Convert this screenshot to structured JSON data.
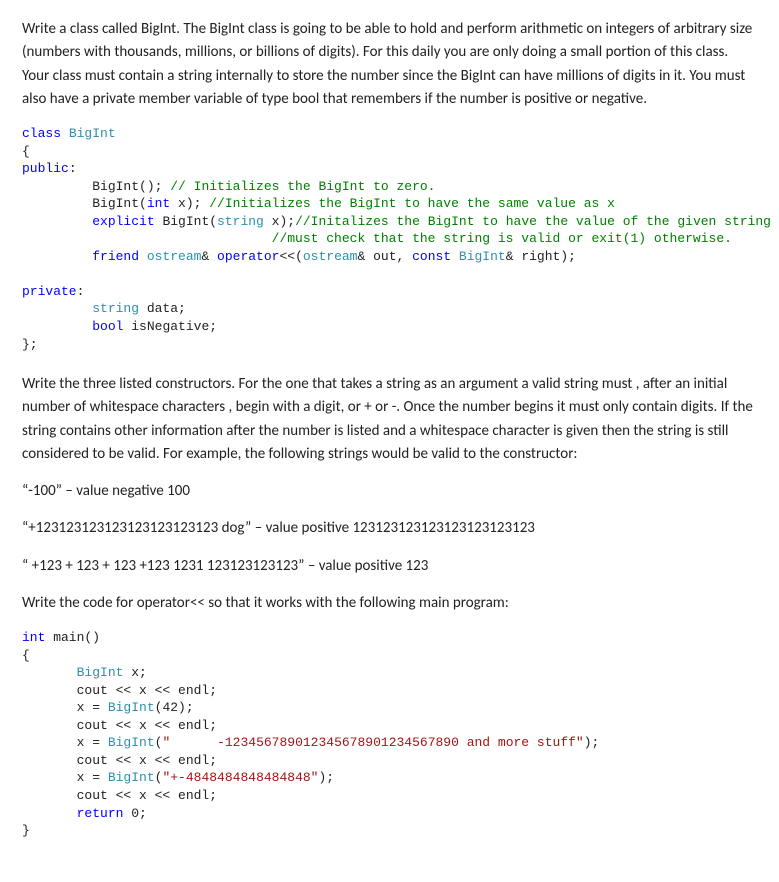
{
  "p1": "Write a class called BigInt.  The BigInt class is going to be able to hold and perform arithmetic on integers of arbitrary size (numbers with thousands, millions, or billions of digits).  For this daily you are only doing a small portion of this class.  Your class must contain a string internally to store the number since the BigInt can have millions of digits in it.  You must also have a private member variable of type bool that remembers if the number is positive or negative.",
  "code1": {
    "l1_kw": "class ",
    "l1_typ": "BigInt",
    "l2": "{",
    "l3_kw": "public",
    "l3_rest": ":",
    "l4_ind": "         ",
    "l4_call": "BigInt(); ",
    "l4_cmt": "// Initializes the BigInt to zero.",
    "l5_ind": "         ",
    "l5_call": "BigInt(",
    "l5_kw": "int",
    "l5_rest": " x); ",
    "l5_cmt": "//Initializes the BigInt to have the same value as x",
    "l6_ind": "         ",
    "l6_kw": "explicit ",
    "l6_call": "BigInt(",
    "l6_typ": "string",
    "l6_rest": " x);",
    "l6_cmt": "//Initalizes the BigInt to have the value of the given string BUT",
    "l7_ind": "                                ",
    "l7_cmt": "//must check that the string is valid or exit(1) otherwise.",
    "l8_ind": "         ",
    "l8_kw": "friend ",
    "l8_typ1": "ostream",
    "l8_mid1": "& ",
    "l8_kw2": "operator",
    "l8_mid2": "<<(",
    "l8_typ2": "ostream",
    "l8_mid3": "& out, ",
    "l8_kw3": "const ",
    "l8_typ3": "BigInt",
    "l8_end": "& right);",
    "l9": "",
    "l10_kw": "private",
    "l10_rest": ":",
    "l11_ind": "         ",
    "l11_typ": "string",
    "l11_rest": " data;",
    "l12_ind": "         ",
    "l12_kw": "bool",
    "l12_rest": " isNegative;",
    "l13": "};"
  },
  "p2": "Write the three listed constructors.  For the one that takes a string as an argument a valid string must , after an initial number of whitespace characters , begin with a digit, or + or -.  Once the number begins it must only contain digits.  If the string contains other information after the number is listed and a whitespace character is given then the string is still considered to be valid.  For example, the following strings would be valid to the constructor:",
  "ex1": "“-100” – value negative 100",
  "ex2": "“+123123123123123123123123 dog” – value positive 123123123123123123123123",
  "ex3": "“     +123 + 123 + 123 +123 1231 123123123123” – value positive 123",
  "p3": "Write the code for operator<< so that it works with the following main program:",
  "code2": {
    "l1_kw": "int",
    "l1_rest": " main()",
    "l2": "{",
    "ind": "       ",
    "l3_typ": "BigInt",
    "l3_rest": " x;",
    "l4": "cout << x << endl;",
    "l5_a": "x = ",
    "l5_typ": "BigInt",
    "l5_b": "(42);",
    "l6": "cout << x << endl;",
    "l7_a": "x = ",
    "l7_typ": "BigInt",
    "l7_b": "(",
    "l7_str": "\"      -123456789012345678901234567890 and more stuff\"",
    "l7_c": ");",
    "l8": "cout << x << endl;",
    "l9_a": "x = ",
    "l9_typ": "BigInt",
    "l9_b": "(",
    "l9_str": "\"+-4848484848484848\"",
    "l9_c": ");",
    "l10": "cout << x << endl;",
    "l11_kw": "return",
    "l11_rest": " 0;",
    "l12": "}"
  }
}
